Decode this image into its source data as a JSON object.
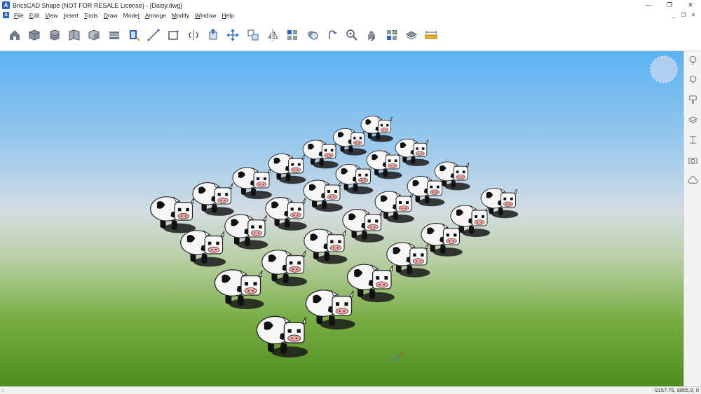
{
  "window": {
    "title": "BricsCAD Shape (NOT FOR RESALE License) - [Daisy.dwg]",
    "minimize": "—",
    "restore": "❐",
    "close": "✕",
    "mdi_minimize": "_",
    "mdi_restore": "❐",
    "mdi_close": "✕"
  },
  "menu": {
    "items": [
      {
        "underline": "F",
        "rest": "ile"
      },
      {
        "underline": "E",
        "rest": "dit"
      },
      {
        "underline": "V",
        "rest": "iew"
      },
      {
        "underline": "I",
        "rest": "nsert"
      },
      {
        "underline": "T",
        "rest": "ools"
      },
      {
        "underline": "D",
        "rest": "raw"
      },
      {
        "pre": "Mode",
        "underline": "l",
        "rest": ""
      },
      {
        "underline": "A",
        "rest": "rrange"
      },
      {
        "underline": "M",
        "rest": "odify"
      },
      {
        "underline": "W",
        "rest": "indow"
      },
      {
        "underline": "H",
        "rest": "elp"
      }
    ]
  },
  "toolbar": {
    "tools": [
      "home-icon",
      "box-icon",
      "cylinder-stack-icon",
      "wall-icon",
      "solid-box-icon",
      "slab-icon",
      "window-icon",
      "line-icon",
      "rectangle-icon",
      "revolve-icon",
      "extrude-icon",
      "move-icon",
      "copy-icon",
      "mirror-icon",
      "array-icon",
      "boolean-icon",
      "rotate-icon",
      "zoom-icon",
      "pan-icon",
      "render-icon",
      "material-icon",
      "measure-icon"
    ]
  },
  "right_panel": {
    "buttons": [
      "lightbulb-icon",
      "tips-icon",
      "paint-icon",
      "layers-icon",
      "section-icon",
      "camera-icon",
      "cloud-icon"
    ]
  },
  "status": {
    "left": ":",
    "coords": "-9157.75, 6865.9, 0"
  },
  "colors": {
    "sky_top": "#5bb2f4",
    "ground": "#4d8c1d",
    "accent": "#2a62c9"
  }
}
